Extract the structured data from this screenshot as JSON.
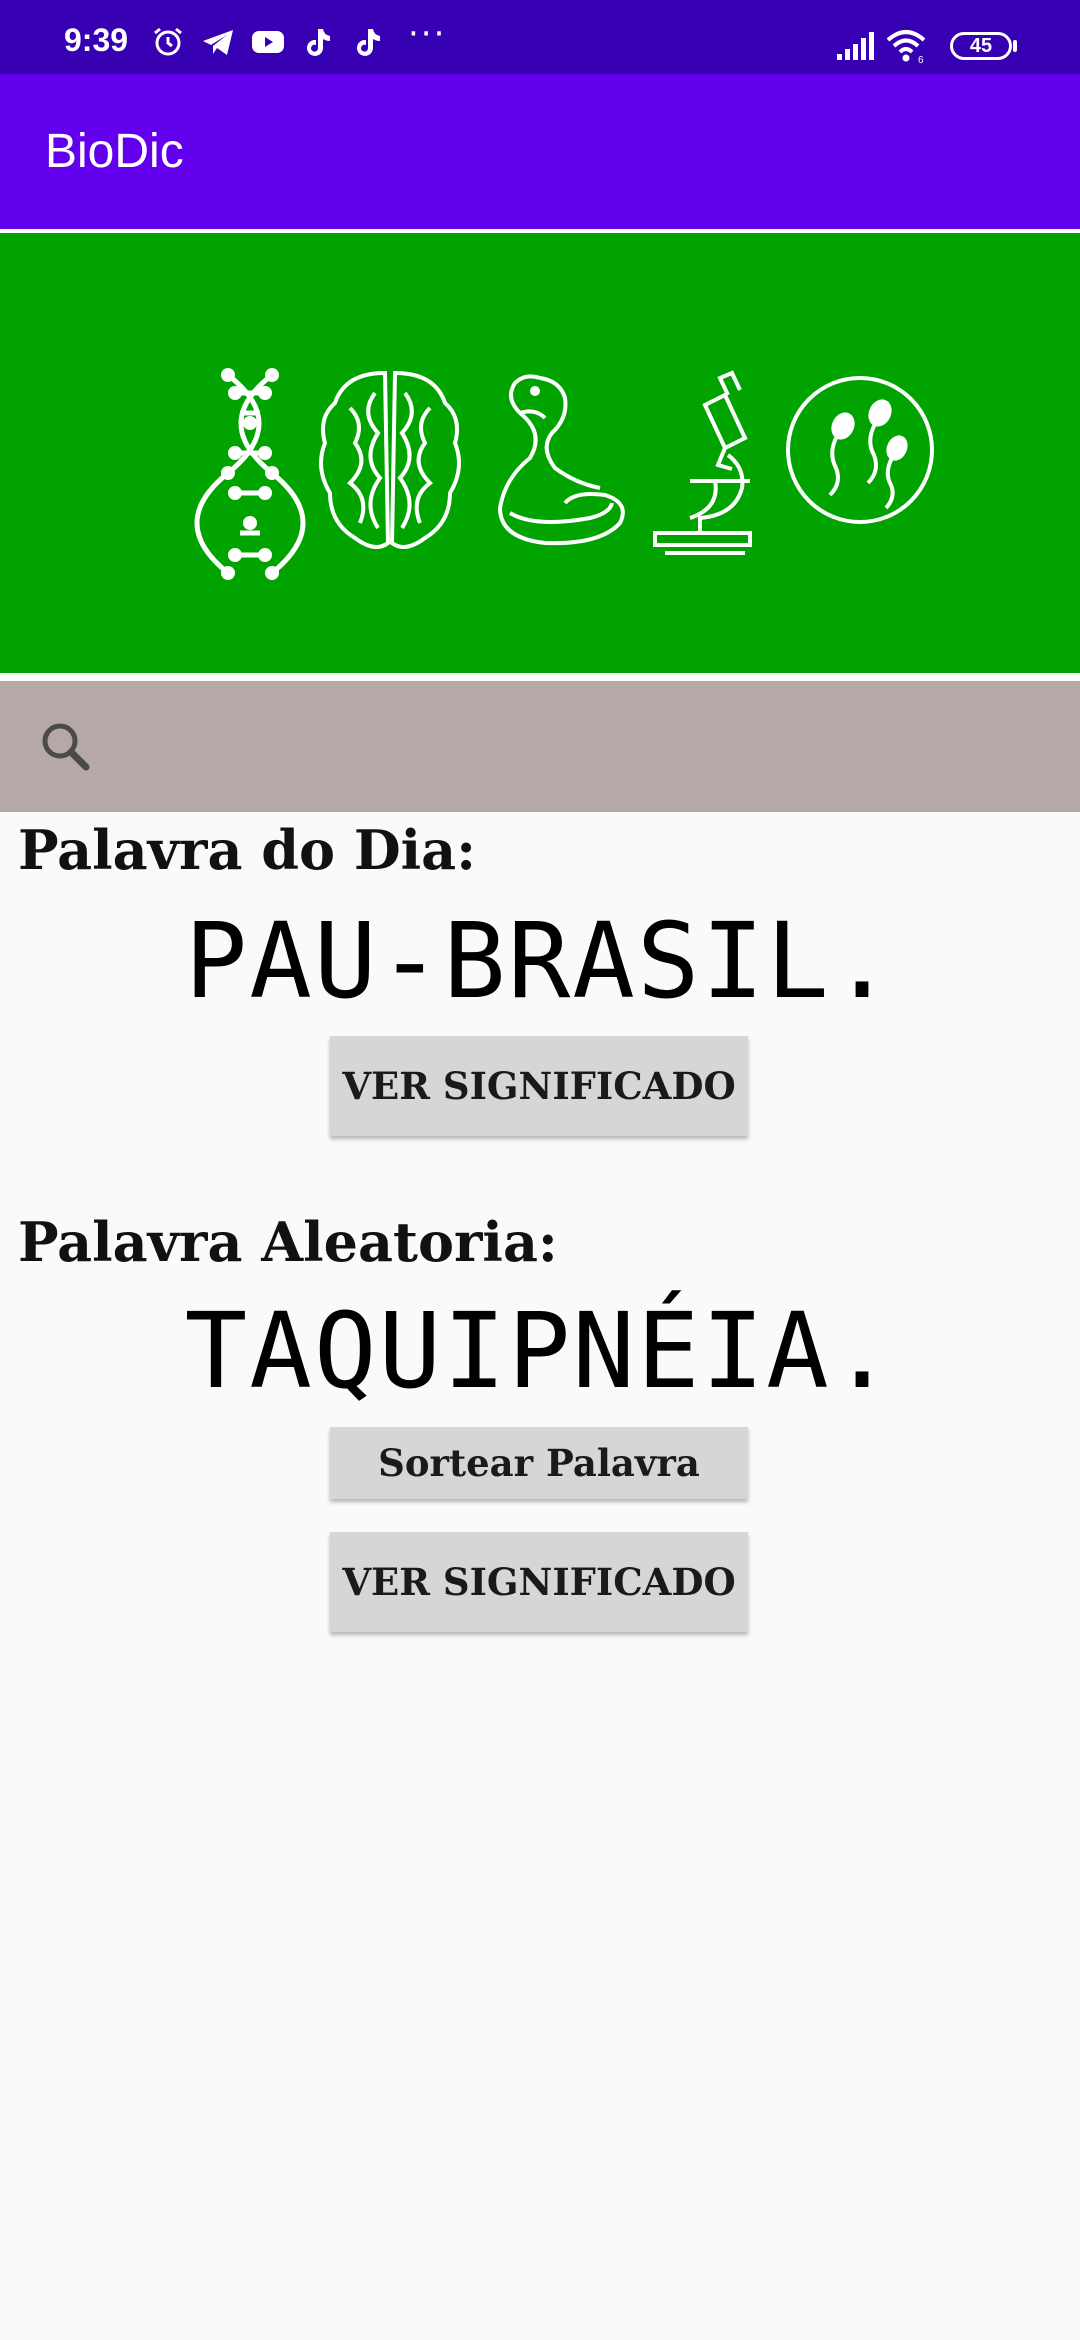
{
  "status_bar": {
    "time": "9:39",
    "battery": "45",
    "more": "···"
  },
  "app_bar": {
    "title": "BioDic"
  },
  "banner": {
    "background": "#00a300",
    "icons": [
      "dna-icon",
      "brain-icon",
      "snake-icon",
      "microscope-icon",
      "sperm-cells-icon"
    ]
  },
  "search": {
    "placeholder": "",
    "value": ""
  },
  "daily": {
    "label": "Palavra do Dia:",
    "word": "PAU-BRASIL.",
    "button_label": "VER SIGNIFICADO"
  },
  "random": {
    "label": "Palavra Aleatoria:",
    "word": "TAQUIPNÉIA.",
    "draw_button_label": "Sortear Palavra",
    "button_label": "VER SIGNIFICADO"
  },
  "colors": {
    "status_bar": "#3700b3",
    "app_bar": "#6200ee",
    "banner": "#00a300",
    "search_bar": "#b5a8a6",
    "button": "#d6d6d6"
  }
}
